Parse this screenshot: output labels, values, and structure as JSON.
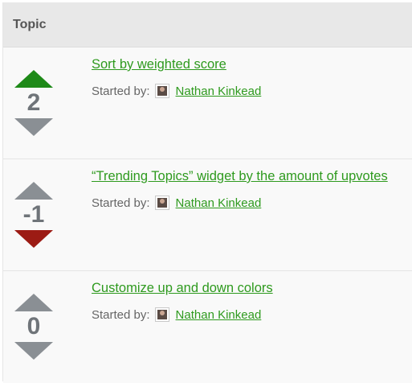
{
  "header": {
    "title": "Topic"
  },
  "colors": {
    "accent": "#2e9a1e",
    "vote_up_active": "#1e8a18",
    "vote_down_active": "#9c1b14",
    "vote_neutral": "#8a8f94"
  },
  "topics": [
    {
      "title": "Sort by weighted score",
      "started_by_label": "Started by:",
      "author": "Nathan Kinkead",
      "score": "2",
      "vote_state": "up"
    },
    {
      "title": "“Trending Topics” widget by the amount of upvotes",
      "started_by_label": "Started by:",
      "author": "Nathan Kinkead",
      "score": "-1",
      "vote_state": "down"
    },
    {
      "title": "Customize up and down colors",
      "started_by_label": "Started by:",
      "author": "Nathan Kinkead",
      "score": "0",
      "vote_state": "none"
    }
  ]
}
